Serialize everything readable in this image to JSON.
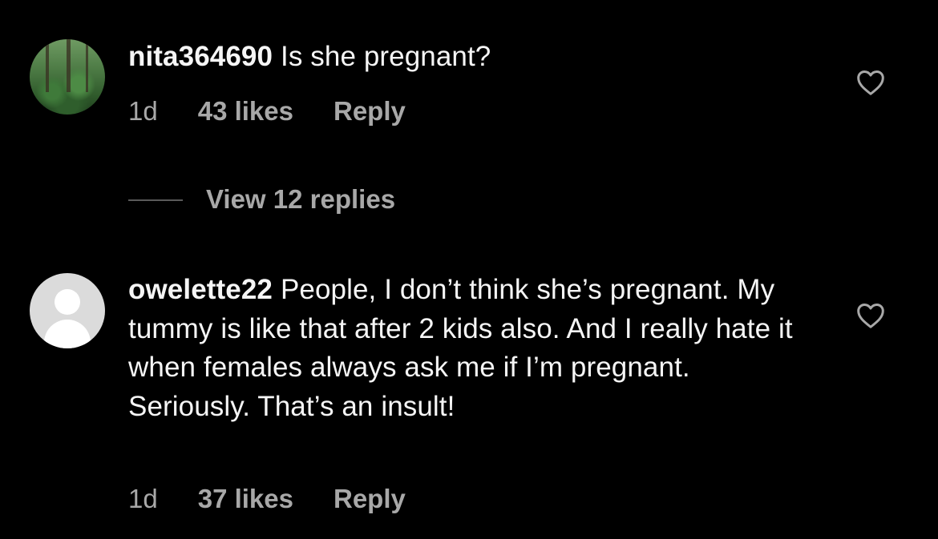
{
  "comments": [
    {
      "username": "nita364690",
      "text": "Is she pregnant?",
      "age": "1d",
      "likes": "43 likes",
      "reply_label": "Reply",
      "avatar_icon": "forest-photo-avatar",
      "like_icon": "heart-outline-icon",
      "view_replies": "View 12 replies"
    },
    {
      "username": "owelette22",
      "text": "People, I don’t think she’s pregnant. My tummy is like that after 2 kids also. And I really hate it when females always ask me if I’m pregnant. Seriously. That’s an insult!",
      "age": "1d",
      "likes": "37 likes",
      "reply_label": "Reply",
      "avatar_icon": "default-user-avatar",
      "like_icon": "heart-outline-icon"
    }
  ],
  "colors": {
    "background": "#000000",
    "primary_text": "#f5f5f5",
    "secondary_text": "#a8a8a8",
    "divider": "#5a5a5a"
  }
}
